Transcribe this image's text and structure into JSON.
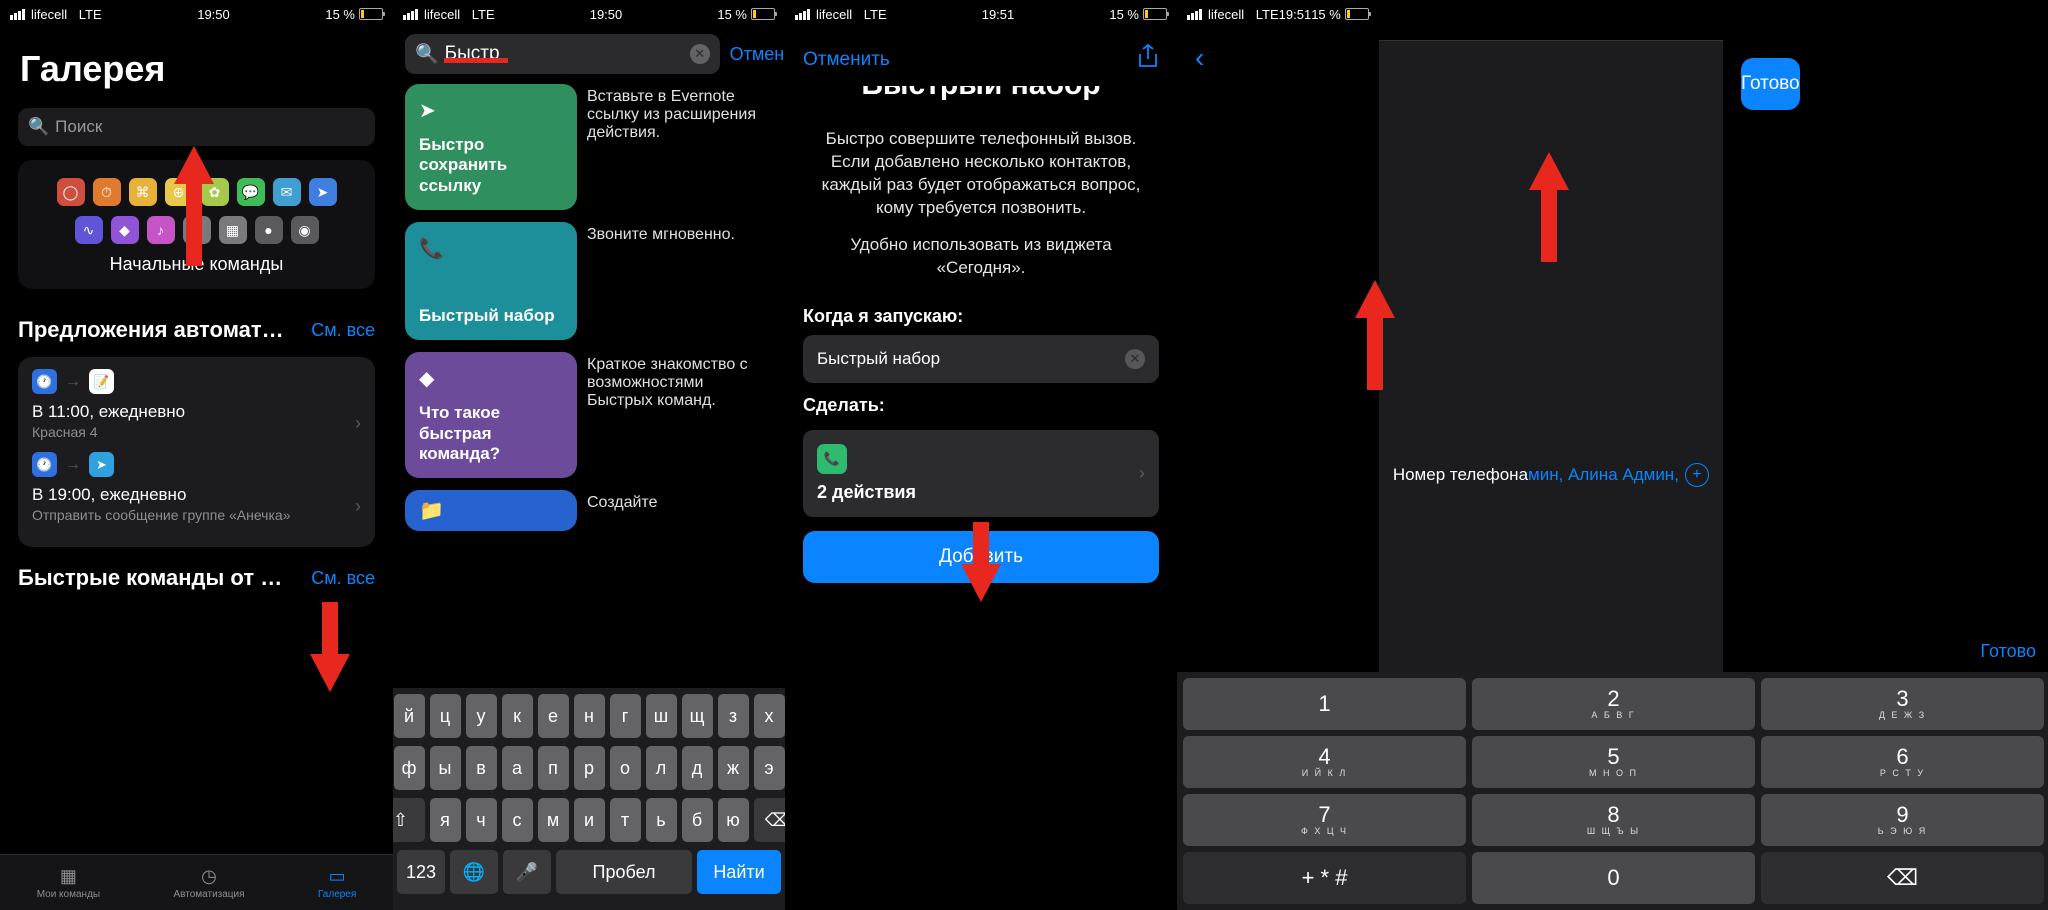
{
  "status": {
    "carrier": "lifecell",
    "net": "LTE",
    "time": "19:50",
    "time_alt": "19:51",
    "battery": "15 %"
  },
  "s1": {
    "title": "Галерея",
    "search_placeholder": "Поиск",
    "starter_title": "Начальные команды",
    "sec1_title": "Предложения автомат…",
    "see_all": "См. все",
    "auto1_title": "В 11:00, ежедневно",
    "auto1_sub": "Красная 4",
    "auto2_title": "В 19:00, ежедневно",
    "auto2_sub": "Отправить сообщение группе «Анечка»",
    "sec2_title": "Быстрые команды от п…",
    "tabs": {
      "my": "Мои команды",
      "auto": "Автоматизация",
      "gal": "Галерея"
    }
  },
  "s2": {
    "query": "Быстр",
    "cancel": "Отменить",
    "r1_title": "Быстро сохранить ссылку",
    "r1_desc": "Вставьте в Evernote ссылку из расширения действия.",
    "r2_title": "Быстрый набор",
    "r2_desc": "Звоните мгновенно.",
    "r3_title": "Что такое быстрая команда?",
    "r3_desc": "Краткое знакомство с возможностями Быстрых команд.",
    "r4_desc": "Создайте",
    "kbd": {
      "row1": [
        "й",
        "ц",
        "у",
        "к",
        "е",
        "н",
        "г",
        "ш",
        "щ",
        "з",
        "х"
      ],
      "row2": [
        "ф",
        "ы",
        "в",
        "а",
        "п",
        "р",
        "о",
        "л",
        "д",
        "ж",
        "э"
      ],
      "row3": [
        "я",
        "ч",
        "с",
        "м",
        "и",
        "т",
        "ь",
        "б",
        "ю"
      ],
      "num": "123",
      "space": "Пробел",
      "find": "Найти"
    }
  },
  "s3": {
    "cancel": "Отменить",
    "title_cut": "Быстрый набор",
    "desc1": "Быстро совершите телефонный вызов. Если добавлено несколько контактов, каждый раз будет отображаться вопрос, кому требуется позвонить.",
    "desc2": "Удобно использовать из виджета «Сегодня».",
    "when_label": "Когда я запускаю:",
    "when_value": "Быстрый набор",
    "do_label": "Сделать:",
    "actions_count": "2 действия",
    "add": "Добавить"
  },
  "s5": {
    "phone_label": "Номер телефона",
    "phone_value": "мин, Алина Админ,",
    "done_big": "Готово",
    "done_small": "Готово",
    "numpad": [
      {
        "n": "1",
        "l": ""
      },
      {
        "n": "2",
        "l": "А Б В Г"
      },
      {
        "n": "3",
        "l": "Д Е Ж З"
      },
      {
        "n": "4",
        "l": "И Й К Л"
      },
      {
        "n": "5",
        "l": "М Н О П"
      },
      {
        "n": "6",
        "l": "Р С Т У"
      },
      {
        "n": "7",
        "l": "Ф Х Ц Ч"
      },
      {
        "n": "8",
        "l": "Ш Щ Ъ Ы"
      },
      {
        "n": "9",
        "l": "Ь Э Ю Я"
      },
      {
        "n": "+ * #",
        "l": ""
      },
      {
        "n": "0",
        "l": ""
      },
      {
        "n": "⌫",
        "l": ""
      }
    ]
  }
}
